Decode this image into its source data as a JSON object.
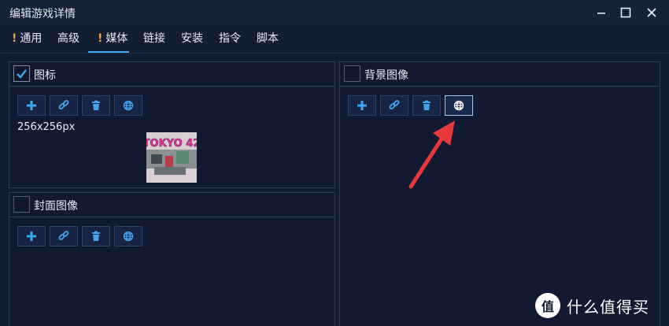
{
  "window": {
    "title": "编辑游戏详情",
    "minimize_glyph": "−",
    "maximize_glyph": "☐",
    "close_glyph": "✕"
  },
  "tabs": [
    {
      "label": "通用",
      "warning": "!",
      "active": false
    },
    {
      "label": "高级",
      "warning": "",
      "active": false
    },
    {
      "label": "媒体",
      "warning": "!",
      "active": true
    },
    {
      "label": "链接",
      "warning": "",
      "active": false
    },
    {
      "label": "安装",
      "warning": "",
      "active": false
    },
    {
      "label": "指令",
      "warning": "",
      "active": false
    },
    {
      "label": "脚本",
      "warning": "",
      "active": false
    }
  ],
  "panels": {
    "icon": {
      "label": "图标",
      "checked": true,
      "size_text": "256x256px",
      "thumbnail_text": "TOKYO 42"
    },
    "cover": {
      "label": "封面图像",
      "checked": false
    },
    "background": {
      "label": "背景图像",
      "checked": false
    }
  },
  "toolbar_icons": [
    "plus-icon",
    "link-icon",
    "trash-icon",
    "globe-icon"
  ],
  "watermark": {
    "text": "什么值得买",
    "badge": "值"
  },
  "colors": {
    "accent": "#3fa6f0",
    "warning": "#f0a23a",
    "arrow": "#e8383b",
    "background": "#121c33"
  }
}
